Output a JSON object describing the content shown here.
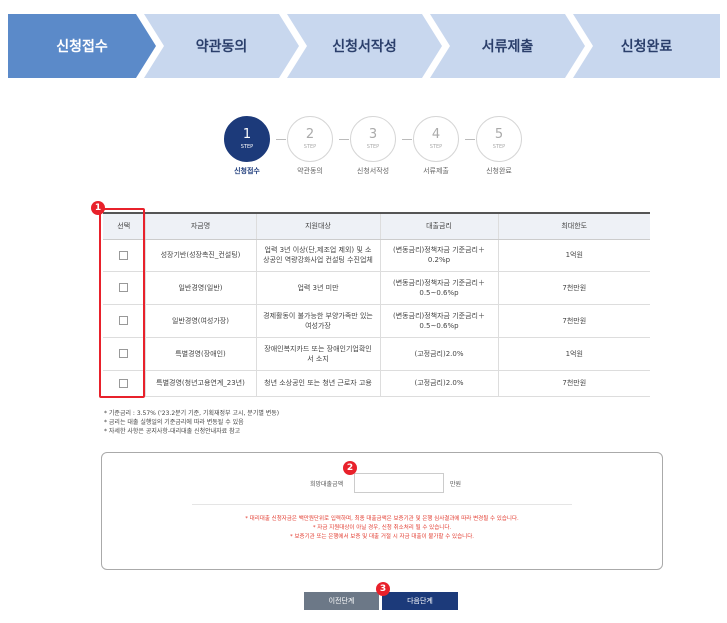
{
  "topbar": {
    "items": [
      {
        "label": "신청접수"
      },
      {
        "label": "약관동의"
      },
      {
        "label": "신청서작성"
      },
      {
        "label": "서류제출"
      },
      {
        "label": "신청완료"
      }
    ],
    "colors": {
      "active": "#5b8ac9",
      "inactive": "#c8d7ee"
    }
  },
  "steps": [
    {
      "num": "1",
      "lbl": "STEP",
      "name": "신청접수"
    },
    {
      "num": "2",
      "lbl": "STEP",
      "name": "약관동의"
    },
    {
      "num": "3",
      "lbl": "STEP",
      "name": "신청서작성"
    },
    {
      "num": "4",
      "lbl": "STEP",
      "name": "서류제출"
    },
    {
      "num": "5",
      "lbl": "STEP",
      "name": "신청완료"
    }
  ],
  "table": {
    "headers": [
      "선택",
      "자금명",
      "지원대상",
      "대출금리",
      "최대한도"
    ],
    "rows": [
      {
        "name": "성장기반(성장촉진_컨설팅)",
        "target": "업력 3년 이상(단,제조업 제외) 및 소상공인 역량강화사업 컨설팅 수진업체",
        "rate": "(변동금리)정책자금 기준금리＋0.2%p",
        "limit": "1억원"
      },
      {
        "name": "일반경영(일반)",
        "target": "업력 3년 미만",
        "rate": "(변동금리)정책자금 기준금리＋0.5~0.6%p",
        "limit": "7천만원"
      },
      {
        "name": "일반경영(여성가장)",
        "target": "경제활동이 불가능한 부양가족만 있는 여성가장",
        "rate": "(변동금리)정책자금 기준금리＋0.5~0.6%p",
        "limit": "7천만원"
      },
      {
        "name": "특별경영(장애인)",
        "target": "장애인복지카드 또는 장애인기업확인서 소지",
        "rate": "(고정금리)2.0%",
        "limit": "1억원"
      },
      {
        "name": "특별경영(청년고용연계_23년)",
        "target": "청년 소상공인 또는 청년 근로자 고용",
        "rate": "(고정금리)2.0%",
        "limit": "7천만원"
      }
    ]
  },
  "notes": [
    "* 기준금리 : 3.57% ('23.2분기 기준, 기획재정부 고시, 분기별 변동)",
    "* 금리는 대출 실행일의 기준금리에 따라 변동될 수 있음",
    "* 자세한 사항은 공지사항-대리대출 신청안내자료 참고"
  ],
  "form": {
    "amount_label": "희망대출금액",
    "amount_value": "",
    "amount_unit": "만원",
    "warnings": [
      "* 대리대출 신청자금은 백만원단위로 입력하며, 최종 대출금액은 보증기관 및 은행 심사결과에 따라 변경될 수 있습니다.",
      "* 자금 지원대상이 아닐 경우, 신청 취소처리 될 수 있습니다.",
      "* 보증기관 또는 은행에서 보증 및 대출 거절 시 자금 대출이 불가할 수 있습니다."
    ]
  },
  "badges": [
    "1",
    "2",
    "3"
  ],
  "buttons": {
    "prev": "이전단계",
    "next": "다음단계"
  }
}
